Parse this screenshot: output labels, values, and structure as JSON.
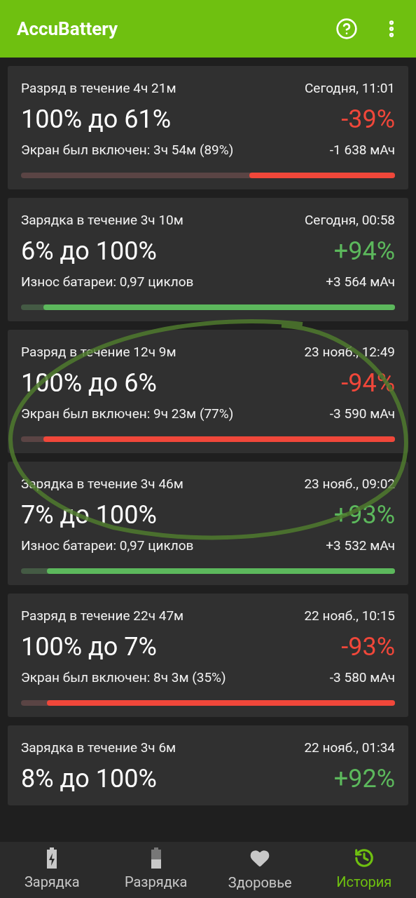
{
  "app_bar": {
    "title": "AccuBattery"
  },
  "sessions": [
    {
      "kind": "discharge",
      "title": "Разряд в течение 4ч 21м",
      "time": "Сегодня, 11:01",
      "range": "100% до 61%",
      "delta": "-39%",
      "detail": "Экран был включен: 3ч 54м (89%)",
      "mah": "-1 638 мАч",
      "level": 0.39
    },
    {
      "kind": "charge",
      "title": "Зарядка в течение 3ч 10м",
      "time": "Сегодня, 00:58",
      "range": "6% до 100%",
      "delta": "+94%",
      "detail": "Износ батареи: 0,97 циклов",
      "mah": "+3 564 мАч",
      "level": 0.94
    },
    {
      "kind": "discharge",
      "title": "Разряд в течение 12ч 9м",
      "time": "23 нояб., 12:49",
      "range": "100% до 6%",
      "delta": "-94%",
      "detail": "Экран был включен: 9ч 23м (77%)",
      "mah": "-3 590 мАч",
      "level": 0.94
    },
    {
      "kind": "charge",
      "title": "Зарядка в течение 3ч 46м",
      "time": "23 нояб., 09:02",
      "range": "7% до 100%",
      "delta": "+93%",
      "detail": "Износ батареи: 0,97 циклов",
      "mah": "+3 532 мАч",
      "level": 0.93
    },
    {
      "kind": "discharge",
      "title": "Разряд в течение 22ч 47м",
      "time": "22 нояб., 10:15",
      "range": "100% до 7%",
      "delta": "-93%",
      "detail": "Экран был включен: 8ч 3м (35%)",
      "mah": "-3 580 мАч",
      "level": 0.93
    },
    {
      "kind": "charge",
      "title": "Зарядка в течение 3ч 6м",
      "time": "22 нояб., 01:34",
      "range": "8% до 100%",
      "delta": "+92%"
    }
  ],
  "bottom_nav": [
    {
      "kind": "charging",
      "label": "Зарядка",
      "selected": false
    },
    {
      "kind": "discharging",
      "label": "Разрядка",
      "selected": false
    },
    {
      "kind": "health",
      "label": "Здоровье",
      "selected": false
    },
    {
      "kind": "history",
      "label": "История",
      "selected": true
    }
  ]
}
